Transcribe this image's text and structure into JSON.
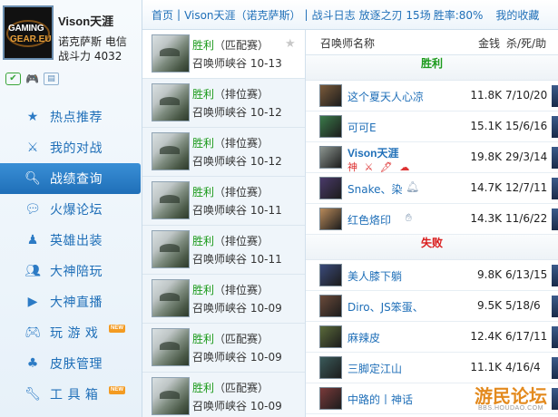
{
  "profile": {
    "avatar_logo_line1": "GAMING",
    "avatar_logo_line2": "GEAR.EU",
    "name": "Vison天涯",
    "server": "诺克萨斯 电信",
    "power": "战斗力 4032"
  },
  "nav": [
    {
      "label": "热点推荐",
      "icon": "star-icon"
    },
    {
      "label": "我的对战",
      "icon": "versus-icon"
    },
    {
      "label": "战绩查询",
      "icon": "search-icon"
    },
    {
      "label": "火爆论坛",
      "icon": "chat-icon"
    },
    {
      "label": "英雄出装",
      "icon": "hero-icon"
    },
    {
      "label": "大神陪玩",
      "icon": "users-icon"
    },
    {
      "label": "大神直播",
      "icon": "play-icon"
    },
    {
      "label": "玩 游 戏",
      "icon": "gamepad-icon",
      "badge": "NEW"
    },
    {
      "label": "皮肤管理",
      "icon": "skin-icon"
    },
    {
      "label": "工 具 箱",
      "icon": "wrench-icon",
      "badge": "NEW"
    }
  ],
  "breadcrumb": {
    "home": "首页",
    "user": "Vison天涯（诺克萨斯）",
    "section": "战斗日志",
    "stats": "放逐之刃 15场",
    "win_rate": "胜率:80%",
    "favorites": "我的收藏"
  },
  "matches": [
    {
      "result": "胜利",
      "mode": "（匹配赛）",
      "map": "召唤师峡谷",
      "date": "10-13"
    },
    {
      "result": "胜利",
      "mode": "（排位赛）",
      "map": "召唤师峡谷",
      "date": "10-12"
    },
    {
      "result": "胜利",
      "mode": "（排位赛）",
      "map": "召唤师峡谷",
      "date": "10-12"
    },
    {
      "result": "胜利",
      "mode": "（排位赛）",
      "map": "召唤师峡谷",
      "date": "10-11"
    },
    {
      "result": "胜利",
      "mode": "（排位赛）",
      "map": "召唤师峡谷",
      "date": "10-11"
    },
    {
      "result": "胜利",
      "mode": "（排位赛）",
      "map": "召唤师峡谷",
      "date": "10-09"
    },
    {
      "result": "胜利",
      "mode": "（匹配赛）",
      "map": "召唤师峡谷",
      "date": "10-09"
    },
    {
      "result": "胜利",
      "mode": "（匹配赛）",
      "map": "召唤师峡谷",
      "date": "10-09"
    }
  ],
  "details": {
    "header": {
      "name": "召唤师名称",
      "gold": "金钱",
      "kda": "杀/死/助"
    },
    "win_title": "胜利",
    "loss_title": "失败",
    "win_team": [
      {
        "name": "这个夏天人心凉",
        "gold": "11.8K",
        "kda": "7/10/20",
        "color": "#7a5a3a"
      },
      {
        "name": "可可E",
        "gold": "15.1K",
        "kda": "15/6/16",
        "color": "#3a7a4a"
      },
      {
        "name": "Vison天涯",
        "gold": "19.8K",
        "kda": "29/3/14",
        "color": "#8c9590",
        "me": true,
        "medals": "神 ⚔ 🖋 ☁"
      },
      {
        "name": "Snake、染",
        "gold": "14.7K",
        "kda": "12/7/11",
        "color": "#4a3a6a",
        "icon": "bell"
      },
      {
        "name": "红色烙印",
        "gold": "14.3K",
        "kda": "11/6/22",
        "color": "#b88a5a",
        "icon": "hand"
      }
    ],
    "loss_team": [
      {
        "name": "美人膝下躺",
        "gold": "9.8K",
        "kda": "6/13/15",
        "color": "#3a4a7a"
      },
      {
        "name": "Diro、JS笨蛋、",
        "gold": "9.5K",
        "kda": "5/18/6",
        "color": "#6a4a3a"
      },
      {
        "name": "麻辣皮",
        "gold": "12.4K",
        "kda": "6/17/11",
        "color": "#5a6a3a"
      },
      {
        "name": "三脚定江山",
        "gold": "11.1K",
        "kda": "4/16/4",
        "color": "#3a5a5a"
      },
      {
        "name": "中路的丨神话",
        "gold": "",
        "kda": "",
        "color": "#7a3a3a"
      }
    ]
  },
  "watermark": {
    "text": "游民论坛",
    "url": "BBS.HOUDAO.COM"
  }
}
